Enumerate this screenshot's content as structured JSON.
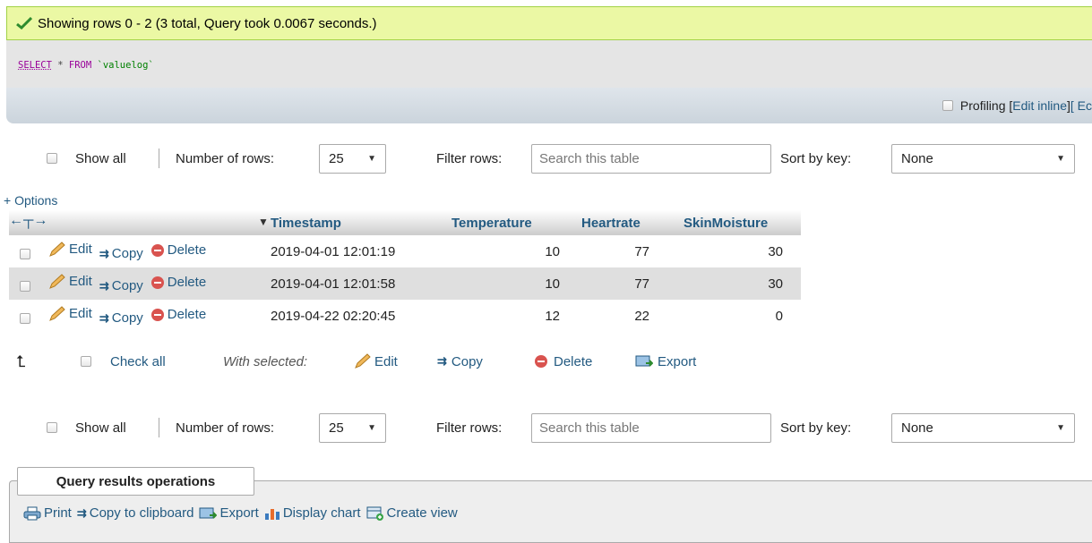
{
  "success_message": "Showing rows 0 - 2 (3 total, Query took 0.0067 seconds.)",
  "sql": {
    "select": "SELECT",
    "star": " * ",
    "from": "FROM",
    "table": " `valuelog`"
  },
  "profiling": {
    "label": "Profiling",
    "edit_inline": "Edit inline",
    "bracket_open": "[",
    "bracket_close": "]",
    "trailing": " [ Ec"
  },
  "nav": {
    "show_all": "Show all",
    "number_of_rows_label": "Number of rows:",
    "number_of_rows_value": "25",
    "filter_rows_label": "Filter rows:",
    "filter_placeholder": "Search this table",
    "sort_by_key_label": "Sort by key:",
    "sort_by_key_value": "None"
  },
  "options_link": "+ Options",
  "table": {
    "columns": [
      "Timestamp",
      "Temperature",
      "Heartrate",
      "SkinMoisture"
    ],
    "actions": {
      "edit": "Edit",
      "copy": "Copy",
      "delete": "Delete"
    },
    "rows": [
      {
        "timestamp": "2019-04-01 12:01:19",
        "temperature": "10",
        "heartrate": "77",
        "skinmoisture": "30"
      },
      {
        "timestamp": "2019-04-01 12:01:58",
        "temperature": "10",
        "heartrate": "77",
        "skinmoisture": "30"
      },
      {
        "timestamp": "2019-04-22 02:20:45",
        "temperature": "12",
        "heartrate": "22",
        "skinmoisture": "0"
      }
    ]
  },
  "with_selected": {
    "check_all": "Check all",
    "label": "With selected:",
    "edit": "Edit",
    "copy": "Copy",
    "delete": "Delete",
    "export": "Export"
  },
  "query_results_operations": {
    "title": "Query results operations",
    "print": "Print",
    "copy_to_clipboard": "Copy to clipboard",
    "export": "Export",
    "display_chart": "Display chart",
    "create_view": "Create view"
  },
  "colors": {
    "link": "#235a81",
    "success_bg": "#ebf8a4",
    "row_alt": "#dfdfdf",
    "delete_red": "#d9534f"
  }
}
